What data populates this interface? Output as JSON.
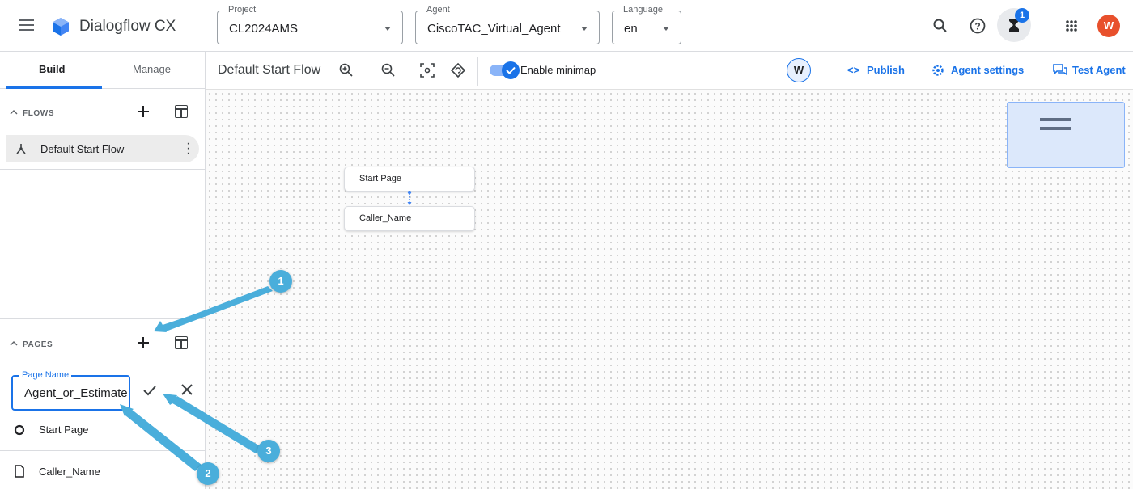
{
  "app": {
    "title": "Dialogflow CX"
  },
  "header": {
    "project": {
      "label": "Project",
      "value": "CL2024AMS"
    },
    "agent": {
      "label": "Agent",
      "value": "CiscoTAC_Virtual_Agent"
    },
    "language": {
      "label": "Language",
      "value": "en"
    },
    "notification_count": "1",
    "user_initial": "W"
  },
  "sidebar": {
    "tabs": [
      {
        "label": "Build",
        "active": true
      },
      {
        "label": "Manage",
        "active": false
      }
    ],
    "flows": {
      "header": "FLOWS",
      "items": [
        {
          "label": "Default Start Flow"
        }
      ]
    },
    "pages": {
      "header": "PAGES",
      "new_page_field": {
        "label": "Page Name",
        "value": "Agent_or_Estimate"
      },
      "items": [
        {
          "label": "Start Page",
          "icon": "circle-icon"
        },
        {
          "label": "Caller_Name",
          "icon": "page-icon"
        }
      ]
    }
  },
  "toolbar": {
    "flow_name": "Default Start Flow",
    "minimap_label": "Enable minimap",
    "minimap_enabled": true,
    "collaborator_initial": "W",
    "publish": "Publish",
    "agent_settings": "Agent settings",
    "test_agent": "Test Agent"
  },
  "canvas": {
    "nodes": [
      {
        "label": "Start Page"
      },
      {
        "label": "Caller_Name"
      }
    ]
  },
  "callouts": [
    "1",
    "2",
    "3"
  ],
  "colors": {
    "accent": "#1a73e8",
    "callout": "#4aaedb",
    "avatar": "#e8502c"
  }
}
